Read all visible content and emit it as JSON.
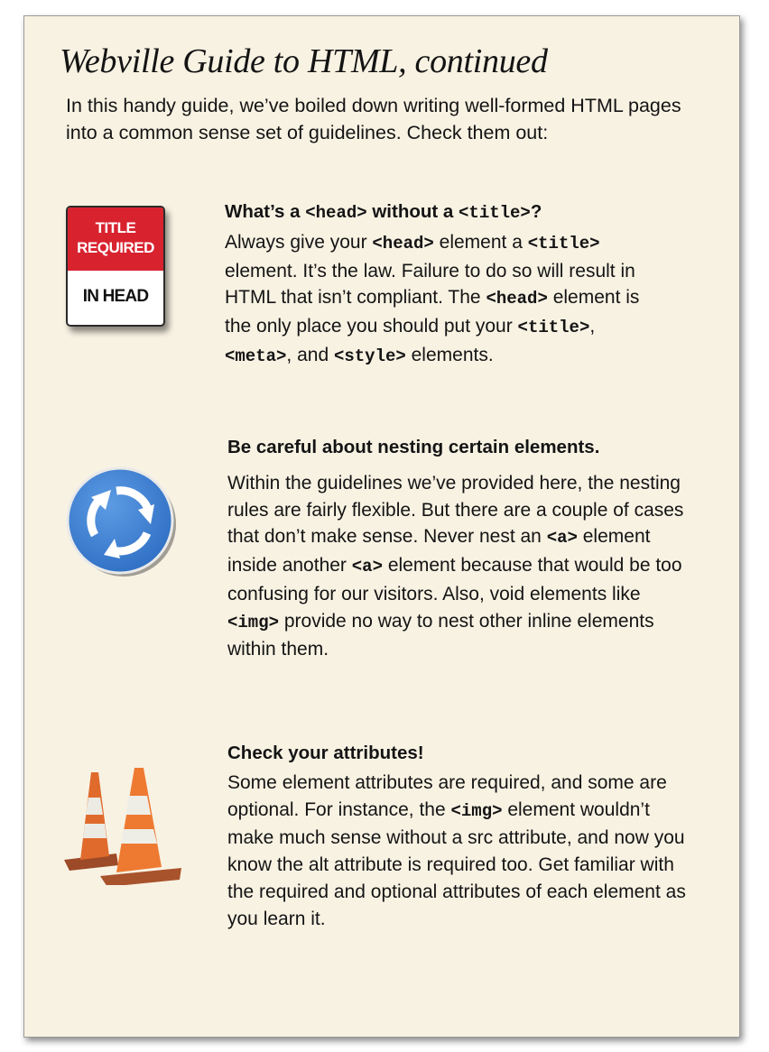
{
  "page": {
    "title": "Webville Guide to HTML, continued",
    "intro": "In this handy guide, we’ve boiled down writing well-formed HTML pages into a common sense set of guidelines. Check them out:"
  },
  "sign": {
    "top_line1": "TITLE",
    "top_line2": "REQUIRED",
    "bottom": "IN HEAD",
    "colors": {
      "red": "#d8232f",
      "white": "#ffffff"
    }
  },
  "sections": [
    {
      "icon": "title-required-sign-icon",
      "heading": {
        "t1": "What’s a ",
        "c1": "<head>",
        "t2": " without a ",
        "c2": "<title>",
        "t3": "?"
      },
      "body": {
        "t1": "Always give your ",
        "c1": "<head>",
        "t2": " element a ",
        "c2": "<title>",
        "t3": " element. It’s the law. Failure to do so will result in HTML that isn’t compliant. The ",
        "c3": "<head>",
        "t4": " element is the only place you should put your ",
        "c4": "<title>",
        "t5": ", ",
        "c5": "<meta>",
        "t6": ", and ",
        "c6": "<style>",
        "t7": " elements."
      }
    },
    {
      "icon": "roundabout-sign-icon",
      "heading": {
        "t1": "Be careful about nesting certain elements."
      },
      "body": {
        "t1": "Within the guidelines we’ve provided here, the nesting rules are fairly flexible. But there are a couple of cases that don’t make sense. Never nest an ",
        "c1": "<a>",
        "t2": " element inside another ",
        "c2": "<a>",
        "t3": " element because that would be too confusing for our visitors. Also, void elements like ",
        "c3": "<img>",
        "t4": " provide no way to nest other inline elements within them."
      }
    },
    {
      "icon": "traffic-cones-icon",
      "heading": {
        "t1": "Check your attributes!"
      },
      "body": {
        "t1": "Some element attributes are required, and some are optional. For instance, the ",
        "c1": "<img>",
        "t2": " element wouldn’t make much sense without a src attribute, and now you know the alt attribute is required too. Get familiar with the required and optional attributes of each element as you learn it."
      }
    }
  ]
}
